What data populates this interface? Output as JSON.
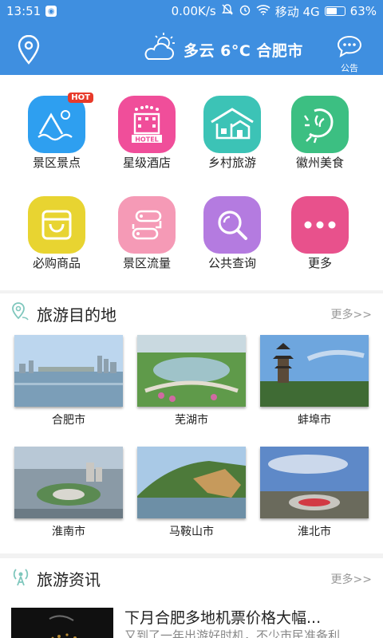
{
  "status": {
    "time": "13:51",
    "speed": "0.00K/s",
    "carrier": "移动 4G",
    "battery": "63%",
    "battery_level": 0.63
  },
  "header": {
    "weather": "多云 6°C 合肥市",
    "notice_label": "公告"
  },
  "grid": [
    {
      "label": "景区景点",
      "icon": "scenic-icon",
      "color": "#2e9ff0",
      "badge": "HOT"
    },
    {
      "label": "星级酒店",
      "icon": "hotel-icon",
      "color": "#f04e9a",
      "hotel_text": "HOTEL"
    },
    {
      "label": "乡村旅游",
      "icon": "village-icon",
      "color": "#3cc3b6"
    },
    {
      "label": "徽州美食",
      "icon": "food-icon",
      "color": "#3cbf82"
    },
    {
      "label": "必购商品",
      "icon": "shopping-bag-icon",
      "color": "#e8d431"
    },
    {
      "label": "景区流量",
      "icon": "traffic-icon",
      "color": "#f59ab6"
    },
    {
      "label": "公共查询",
      "icon": "search-icon",
      "color": "#b47be0"
    },
    {
      "label": "更多",
      "icon": "more-icon",
      "color": "#e8518c"
    }
  ],
  "destinations": {
    "title": "旅游目的地",
    "more": "更多>>",
    "cities": [
      "合肥市",
      "芜湖市",
      "蚌埠市",
      "淮南市",
      "马鞍山市",
      "淮北市"
    ]
  },
  "news": {
    "title": "旅游资讯",
    "more": "更多>>",
    "items": [
      {
        "title": "下月合肥多地机票价格大幅...",
        "summary": "又到了一年出游好时机，不少市民准备利"
      }
    ]
  }
}
